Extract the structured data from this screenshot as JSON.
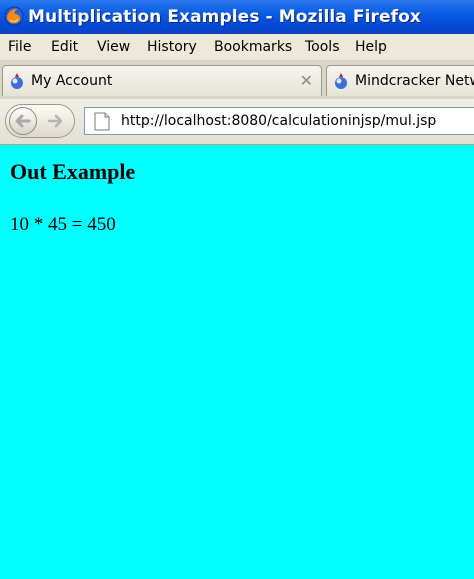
{
  "window": {
    "title": "Multiplication Examples - Mozilla Firefox"
  },
  "menu": {
    "items": [
      "File",
      "Edit",
      "View",
      "History",
      "Bookmarks",
      "Tools",
      "Help"
    ]
  },
  "tabs": [
    {
      "label": "My Account",
      "icon": "page-favicon-icon"
    },
    {
      "label": "Mindcracker Netwo",
      "icon": "page-favicon-icon"
    }
  ],
  "navigation": {
    "url": "http://localhost:8080/calculationinjsp/mul.jsp"
  },
  "page": {
    "heading": "Out Example",
    "result": "10 * 45 = 450"
  },
  "colors": {
    "page_background": "#00FFFF",
    "titlebar": "#0548d6"
  }
}
